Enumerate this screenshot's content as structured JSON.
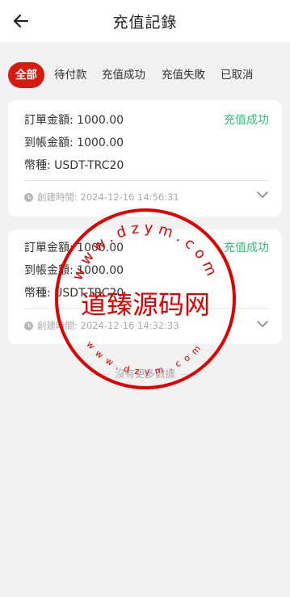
{
  "header": {
    "title": "充值記錄",
    "back_icon": "arrow-left-icon"
  },
  "tabs": [
    {
      "label": "全部",
      "active": true
    },
    {
      "label": "待付款",
      "active": false
    },
    {
      "label": "充值成功",
      "active": false
    },
    {
      "label": "充值失敗",
      "active": false
    },
    {
      "label": "已取消",
      "active": false
    }
  ],
  "records": [
    {
      "amount": "訂單金額: 1000.00",
      "received": "到帳金額: 1000.00",
      "currency": "幣種: USDT-TRC20",
      "status": "充值成功",
      "created": "創建時間: 2024-12-16 14:56:31"
    },
    {
      "amount": "訂單金額: 1000.00",
      "received": "到帳金額: 1000.00",
      "currency": "幣種: USDT-TRC20",
      "status": "充值成功",
      "created": "創建時間: 2024-12-16 14:32:33"
    }
  ],
  "footer": {
    "no_more": "沒有更多數據"
  },
  "watermark": {
    "center_text": "道臻源码网",
    "ring_top": "www.dzym.com",
    "ring_bottom": "www.dzym.com",
    "color": "#e00000"
  },
  "colors": {
    "accent": "#d51a10",
    "success": "#2fc27a"
  }
}
